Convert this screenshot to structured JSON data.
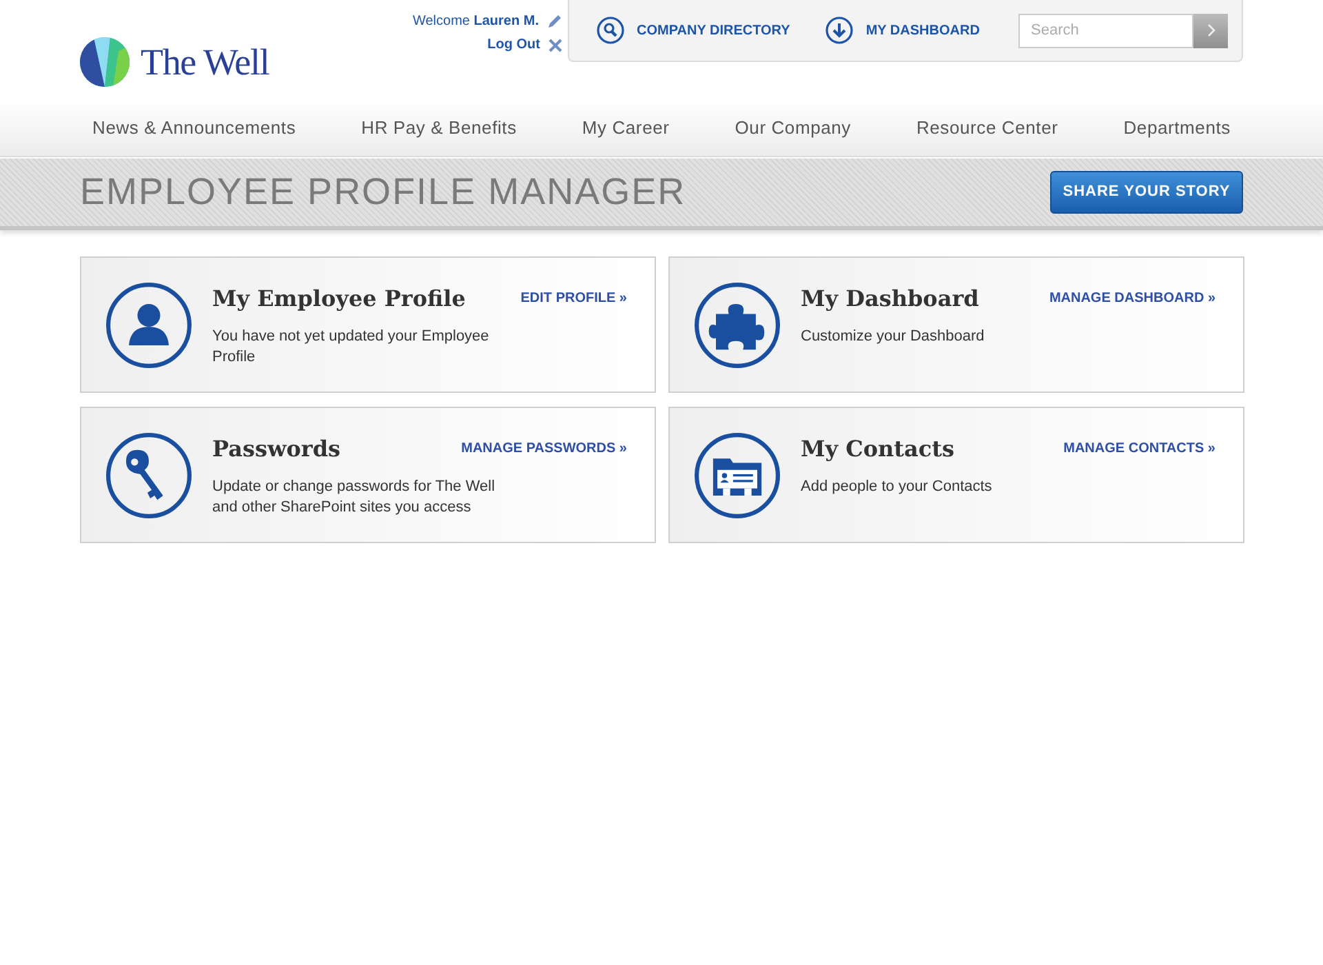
{
  "logo": {
    "text": "The Well"
  },
  "user": {
    "welcome": "Welcome **Lauren M.**",
    "logout": "Log Out"
  },
  "quick_links": [
    {
      "label": "COMPANY DIRECTORY",
      "kind": "search"
    },
    {
      "label": "MY DASHBOARD",
      "kind": "down"
    }
  ],
  "search": {
    "placeholder": "Search"
  },
  "nav": [
    "News & Announcements",
    "HR Pay & Benefits",
    "My Career",
    "Our Company",
    "Resource Center",
    "Departments"
  ],
  "banner": {
    "title": "EMPLOYEE PROFILE MANAGER",
    "button": "SHARE YOUR STORY"
  },
  "cards": [
    {
      "kind": "person",
      "title": "My Employee Profile",
      "link": "EDIT PROFILE »",
      "text": "You have not yet updated your Employee Profile"
    },
    {
      "kind": "puzzle",
      "title": "My Dashboard",
      "link": "MANAGE DASHBOARD »",
      "text": "Customize your Dashboard"
    },
    {
      "kind": "key",
      "title": "Passwords",
      "link": "MANAGE PASSWORDS »",
      "text": "Update or change passwords for The Well and other SharePoint sites you access"
    },
    {
      "kind": "contacts",
      "title": "My Contacts",
      "link": "MANAGE CONTACTS »",
      "text": "Add people to your Contacts"
    }
  ]
}
